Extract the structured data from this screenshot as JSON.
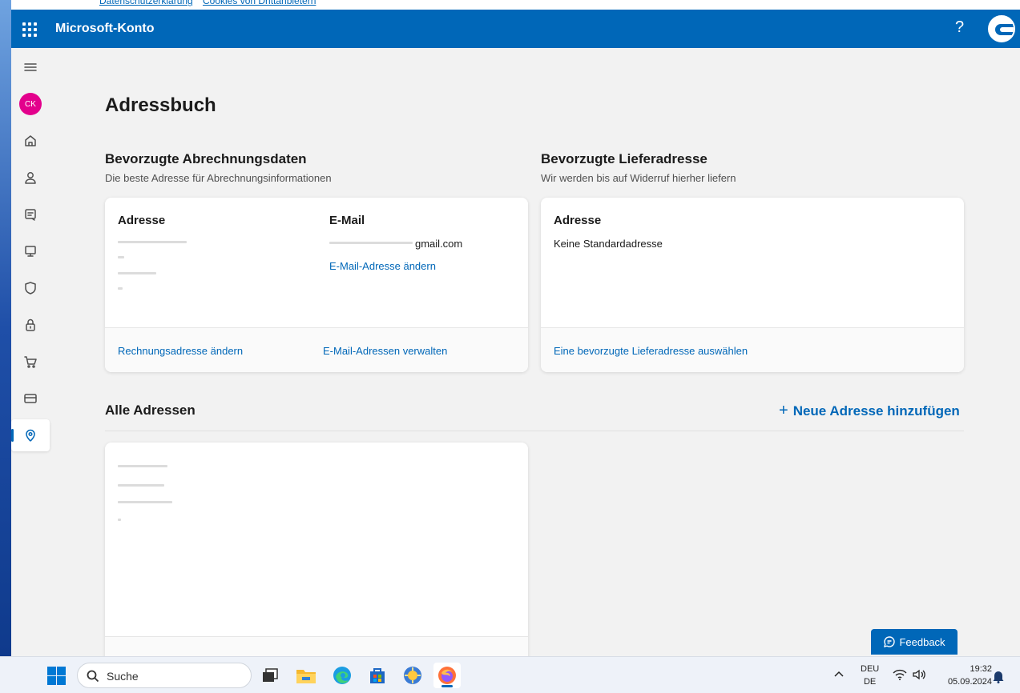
{
  "top_links": {
    "privacy": "Datenschutzerklärung",
    "cookies": "Cookies von Drittanbietern"
  },
  "header": {
    "app_name": "Microsoft-Konto",
    "help": "?"
  },
  "sidebar": {
    "avatar_initials": "CK",
    "items": [
      "menu",
      "home",
      "your-info",
      "subscriptions",
      "devices",
      "privacy",
      "security",
      "payment-options",
      "order-history",
      "addresses"
    ]
  },
  "page": {
    "title": "Adressbuch"
  },
  "billing": {
    "title": "Bevorzugte Abrechnungsdaten",
    "subtitle": "Die beste Adresse für Abrechnungsinformationen",
    "address_label": "Adresse",
    "email_label": "E-Mail",
    "email_value": "gmail.com",
    "change_email_link": "E-Mail-Adresse ändern",
    "footer_link_1": "Rechnungsadresse ändern",
    "footer_link_2": "E-Mail-Adressen verwalten"
  },
  "shipping": {
    "title": "Bevorzugte Lieferadresse",
    "subtitle": "Wir werden bis auf Widerruf hierher liefern",
    "address_label": "Adresse",
    "no_default": "Keine Standardadresse",
    "footer_link": "Eine bevorzugte Lieferadresse auswählen"
  },
  "all_addresses": {
    "title": "Alle Adressen",
    "add_plus": "+",
    "add_label": "Neue Adresse hinzufügen"
  },
  "feedback": {
    "label": "Feedback"
  },
  "taskbar": {
    "search_placeholder": "Suche",
    "lang_1": "DEU",
    "lang_2": "DE",
    "time": "19:32",
    "date": "05.09.2024"
  },
  "colors": {
    "brand": "#0067b8",
    "avatar": "#e3008c"
  }
}
